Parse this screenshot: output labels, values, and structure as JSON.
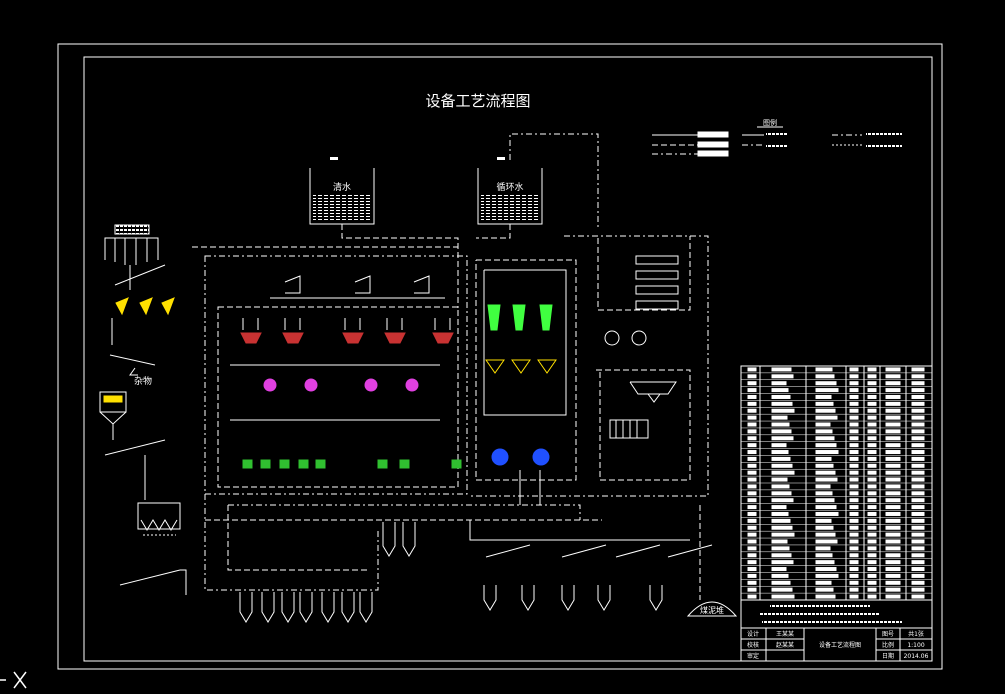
{
  "drawing": {
    "title": "设备工艺流程图",
    "tank_clean_water": "清水",
    "tank_circulating_water": "循环水",
    "debris": "杂物",
    "slime_pile": "煤泥堆",
    "legend_heading": "图例",
    "title_block": {
      "role_design": "设计",
      "role_check": "校核",
      "role_review": "审定",
      "designer": "王某某",
      "checker": "赵某某",
      "drawing_name": "设备工艺流程图",
      "key_scale": "比例",
      "val_scale": "1:100",
      "key_date": "日期",
      "val_date": "2014.06",
      "key_sheet": "图号",
      "key_sheets": "共1张"
    }
  },
  "colors": {
    "line": "#ffffff",
    "cyclone_red": "#c83232",
    "magnetic_separator_magenta": "#e040e0",
    "flotation_green": "#30c030",
    "column_cell_green": "#40ff40",
    "thickener_yellow": "#ffe000",
    "filter_blue": "#2050ff",
    "tank_fill": "#ffffff"
  },
  "icons": {
    "ucs": "ucs-axis-icon"
  }
}
